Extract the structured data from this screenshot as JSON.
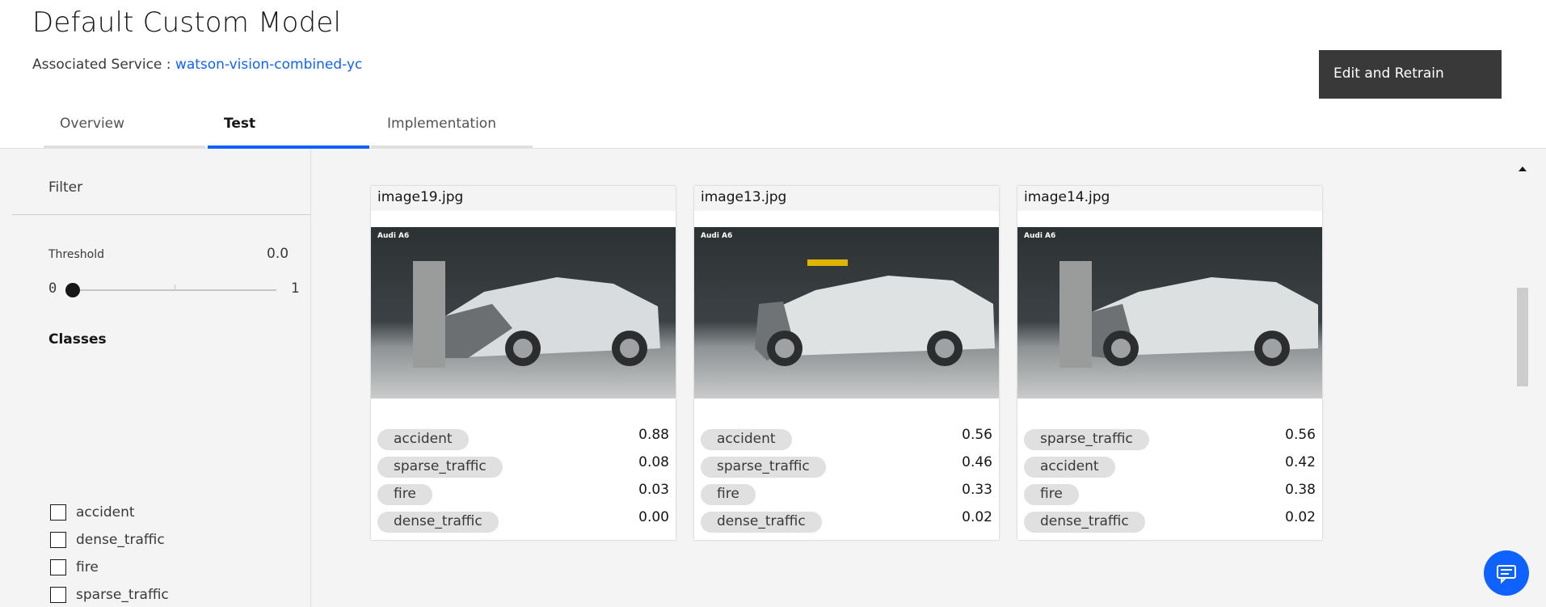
{
  "page": {
    "title": "Default Custom Model",
    "service_label": "Associated Service :",
    "service_link": "watson-vision-combined-yc",
    "edit_button": "Edit and Retrain"
  },
  "tabs": [
    {
      "label": "Overview",
      "active": false
    },
    {
      "label": "Test",
      "active": true
    },
    {
      "label": "Implementation",
      "active": false
    }
  ],
  "sidebar": {
    "filter_label": "Filter",
    "threshold_label": "Threshold",
    "threshold_value": "0.0",
    "slider_min": "0",
    "slider_max": "1",
    "classes_label": "Classes",
    "classes": [
      "accident",
      "dense_traffic",
      "fire",
      "sparse_traffic"
    ]
  },
  "cards": [
    {
      "filename": "image19.jpg",
      "image_caption": "Audi A6",
      "scores": [
        {
          "class": "accident",
          "score": "0.88"
        },
        {
          "class": "sparse_traffic",
          "score": "0.08"
        },
        {
          "class": "fire",
          "score": "0.03"
        },
        {
          "class": "dense_traffic",
          "score": "0.00"
        }
      ]
    },
    {
      "filename": "image13.jpg",
      "image_caption": "Audi A6",
      "scores": [
        {
          "class": "accident",
          "score": "0.56"
        },
        {
          "class": "sparse_traffic",
          "score": "0.46"
        },
        {
          "class": "fire",
          "score": "0.33"
        },
        {
          "class": "dense_traffic",
          "score": "0.02"
        }
      ]
    },
    {
      "filename": "image14.jpg",
      "image_caption": "Audi A6",
      "scores": [
        {
          "class": "sparse_traffic",
          "score": "0.56"
        },
        {
          "class": "accident",
          "score": "0.42"
        },
        {
          "class": "fire",
          "score": "0.38"
        },
        {
          "class": "dense_traffic",
          "score": "0.02"
        }
      ]
    }
  ],
  "colors": {
    "accent": "#0f62fe",
    "button_dark": "#393939",
    "background": "#f4f4f4"
  },
  "icons": {
    "chat": "chat-icon",
    "scroll_up": "scroll-up-arrow-icon"
  }
}
